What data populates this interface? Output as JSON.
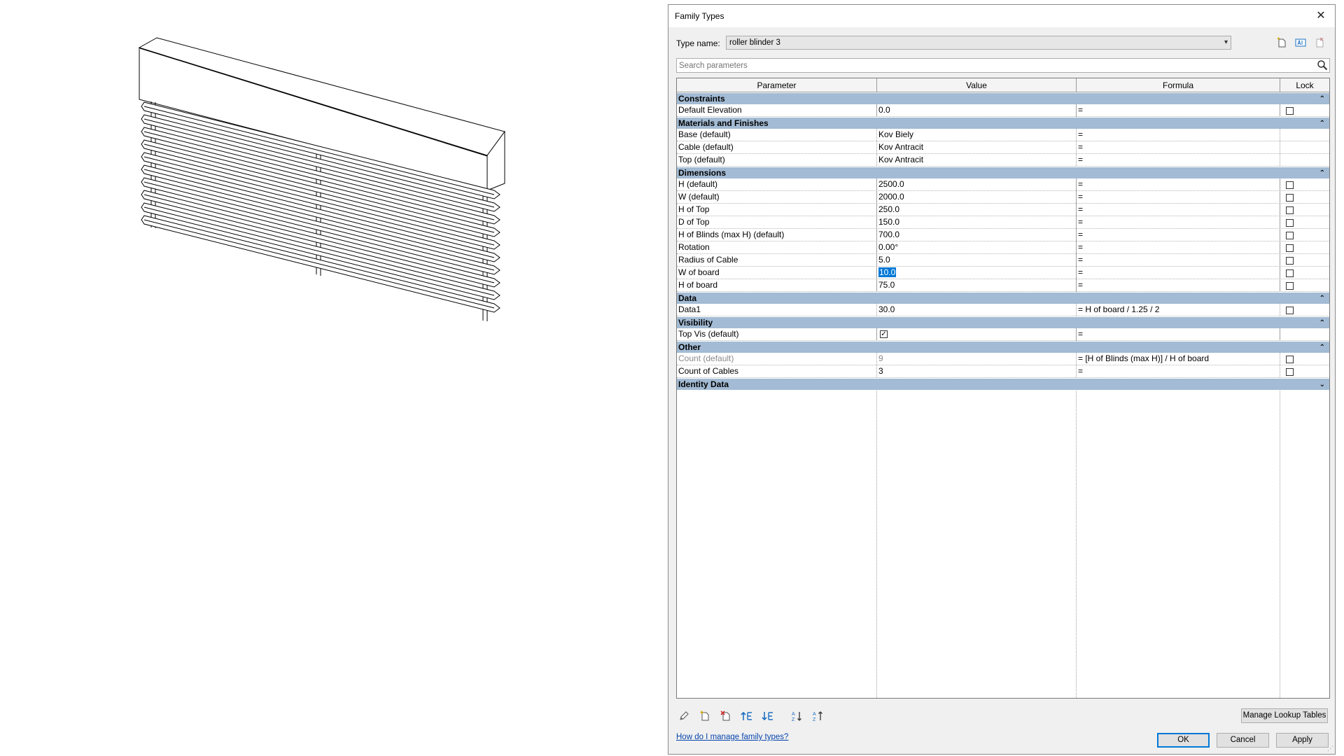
{
  "dialog": {
    "title": "Family Types",
    "close_glyph": "✕",
    "type_name_label": "Type name:",
    "type_name_value": "roller blinder 3",
    "search_placeholder": "Search parameters",
    "columns": [
      "Parameter",
      "Value",
      "Formula",
      "Lock"
    ],
    "groups": {
      "constraints": {
        "title": "Constraints",
        "rows": [
          {
            "param": "Default Elevation",
            "value": "0.0",
            "formula": "="
          }
        ]
      },
      "materials": {
        "title": "Materials and Finishes",
        "rows": [
          {
            "param": "Base (default)",
            "value": "Kov Biely",
            "formula": "="
          },
          {
            "param": "Cable (default)",
            "value": "Kov Antracit",
            "formula": "="
          },
          {
            "param": "Top (default)",
            "value": "Kov Antracit",
            "formula": "="
          }
        ]
      },
      "dimensions": {
        "title": "Dimensions",
        "rows": [
          {
            "param": "H (default)",
            "value": "2500.0",
            "formula": "="
          },
          {
            "param": "W (default)",
            "value": "2000.0",
            "formula": "="
          },
          {
            "param": "H of Top",
            "value": "250.0",
            "formula": "="
          },
          {
            "param": "D of Top",
            "value": "150.0",
            "formula": "="
          },
          {
            "param": "H of Blinds (max H) (default)",
            "value": "700.0",
            "formula": "="
          },
          {
            "param": "Rotation",
            "value": "0.00°",
            "formula": "="
          },
          {
            "param": "Radius of Cable",
            "value": "5.0",
            "formula": "="
          },
          {
            "param": "W of board",
            "value": "10.0",
            "formula": "="
          },
          {
            "param": "H of board",
            "value": "75.0",
            "formula": "="
          }
        ]
      },
      "data": {
        "title": "Data",
        "rows": [
          {
            "param": "Data1",
            "value": "30.0",
            "formula": "= H of board / 1.25 / 2"
          }
        ]
      },
      "visibility": {
        "title": "Visibility",
        "rows": [
          {
            "param": "Top Vis (default)",
            "value_checked": true,
            "formula": "="
          }
        ]
      },
      "other": {
        "title": "Other",
        "rows": [
          {
            "param": "Count (default)",
            "value": "9",
            "formula": "= [H of Blinds (max H)] / H of board"
          },
          {
            "param": "Count of Cables",
            "value": "3",
            "formula": "="
          }
        ]
      },
      "identity": {
        "title": "Identity Data"
      }
    },
    "group_toggle_glyph_up": "⌃",
    "group_toggle_glyph_down": "⌄",
    "buttons": {
      "manage_lookup": "Manage Lookup Tables",
      "ok": "OK",
      "cancel": "Cancel",
      "apply": "Apply"
    },
    "help_link": "How do I manage family types?",
    "icons": {
      "type_tools": [
        "new-type-icon",
        "rename-type-icon",
        "delete-type-icon"
      ],
      "param_tools": [
        "edit-parameter-icon",
        "new-parameter-icon",
        "delete-parameter-icon",
        "move-up-icon",
        "move-down-icon",
        "sort-ascending-icon",
        "sort-descending-icon"
      ]
    },
    "colors": {
      "group_header": "#a3bbd4",
      "selection": "#0078d7",
      "link": "#0645ad",
      "icon_blue": "#1e6fc2",
      "icon_red": "#d12a2a"
    }
  }
}
